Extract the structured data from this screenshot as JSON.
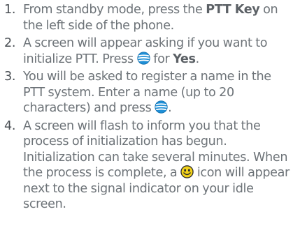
{
  "steps": [
    {
      "number": "1.",
      "text_a": "From standby mode, press the ",
      "bold": "PTT Key",
      "text_b": " on the left side of the phone."
    },
    {
      "number": "2.",
      "text_a": "A screen will appear asking if you want to initialize PTT. Press ",
      "icon": "att-globe-key-icon",
      "text_b": " for ",
      "bold": "Yes",
      "text_c": "."
    },
    {
      "number": "3.",
      "text_a": "You will be asked to register a name in the PTT system. Enter a name (up to 20 characters) and press ",
      "icon": "att-globe-key-icon",
      "text_b": "."
    },
    {
      "number": "4.",
      "text_a": "A screen will flash to inform you that the process of initialization has begun. Initialization can take several minutes. When the process is complete, a ",
      "icon": "smiley-ptt-icon",
      "text_b": " icon will appear next to the signal indicator on your idle screen."
    }
  ],
  "colors": {
    "text": "#6d7378",
    "number": "#4a4f54",
    "globe_blue": "#1f8fd6",
    "smiley_yellow": "#f2d21a"
  }
}
